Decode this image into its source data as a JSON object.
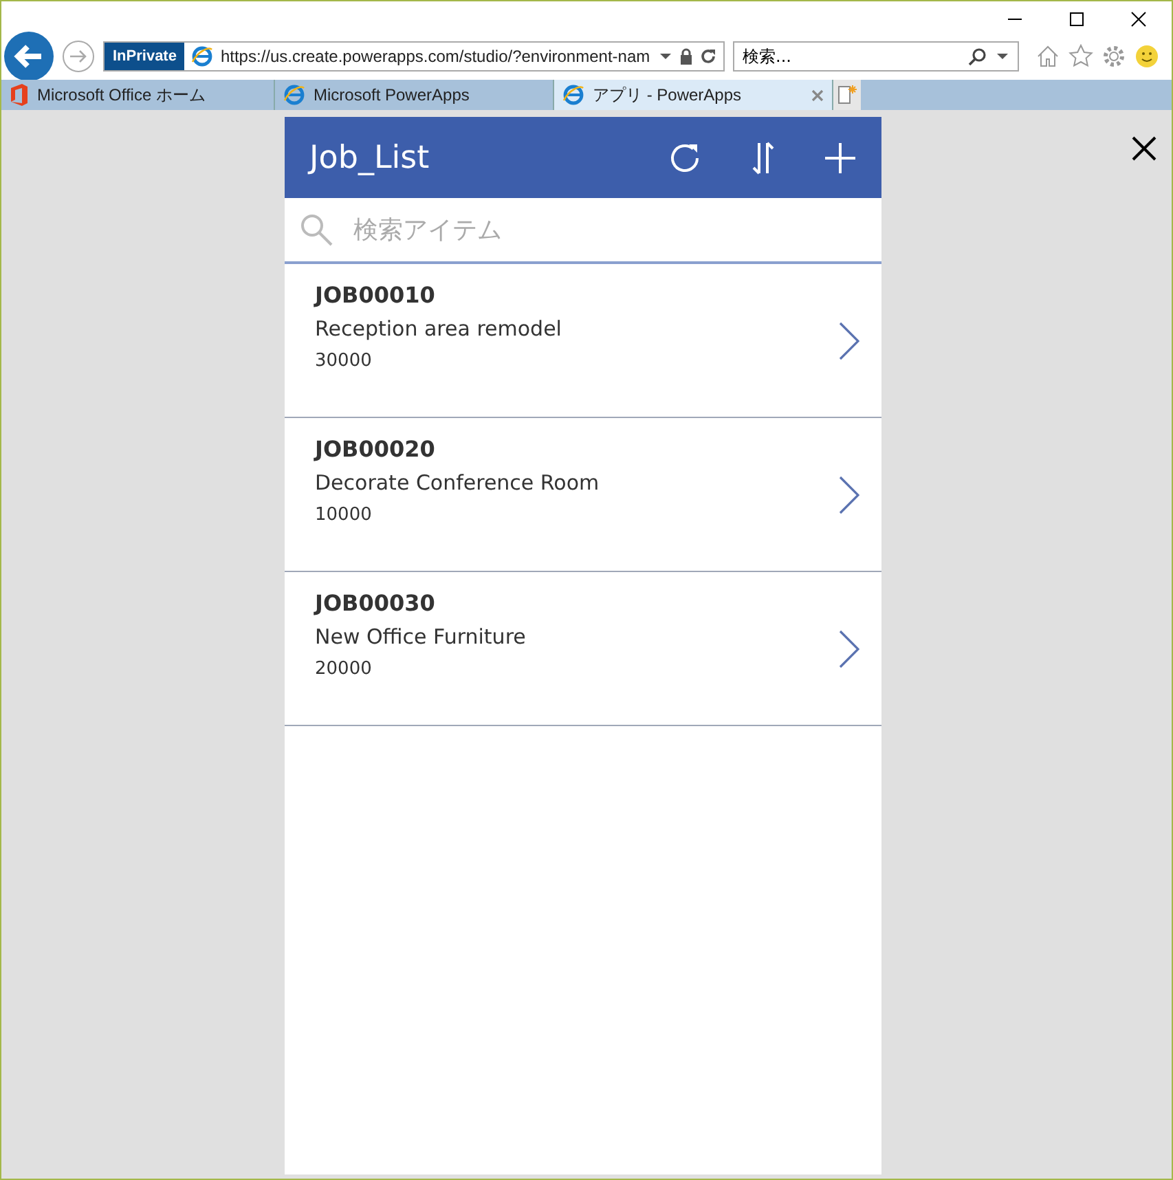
{
  "browser": {
    "inprivate": "InPrivate",
    "address": "https://us.create.powerapps.com/studio/?environment-nam",
    "search": {
      "value": "検索..."
    },
    "tabs": [
      {
        "label": "Microsoft Office ホーム",
        "kind": "office",
        "selected": false
      },
      {
        "label": "Microsoft PowerApps",
        "kind": "ie",
        "selected": false
      },
      {
        "label": "アプリ - PowerApps",
        "kind": "ie",
        "selected": true
      }
    ]
  },
  "app": {
    "title": "Job_List",
    "search": {
      "placeholder": "検索アイテム"
    },
    "items": [
      {
        "id": "JOB00010",
        "name": "Reception area remodel",
        "amount": "30000"
      },
      {
        "id": "JOB00020",
        "name": "Decorate Conference Room",
        "amount": "10000"
      },
      {
        "id": "JOB00030",
        "name": "New Office Furniture",
        "amount": "20000"
      }
    ]
  }
}
